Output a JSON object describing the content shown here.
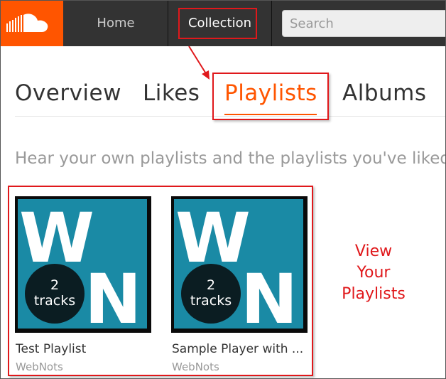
{
  "header": {
    "logo_icon": "soundcloud-logo-icon",
    "nav": {
      "home_label": "Home",
      "collection_label": "Collection"
    },
    "search": {
      "placeholder": "Search",
      "value": ""
    }
  },
  "tabs": [
    {
      "label": "Overview"
    },
    {
      "label": "Likes"
    },
    {
      "label": "Playlists",
      "active": true
    },
    {
      "label": "Albums"
    }
  ],
  "subtitle": "Hear your own playlists and the playlists you've liked:",
  "playlists": [
    {
      "title": "Test Playlist",
      "user": "WebNots",
      "tracks_count": "2",
      "tracks_label": "tracks",
      "art_letters": "WN"
    },
    {
      "title": "Sample Player with ...",
      "user": "WebNots",
      "tracks_count": "2",
      "tracks_label": "tracks",
      "art_letters": "WN"
    }
  ],
  "annotation": {
    "lines": [
      "View",
      "Your",
      "Playlists"
    ]
  },
  "colors": {
    "brand": "#ff5500",
    "annotation_red": "#e0181b",
    "topbar": "#333333",
    "art_teal": "#1a8aa5"
  }
}
